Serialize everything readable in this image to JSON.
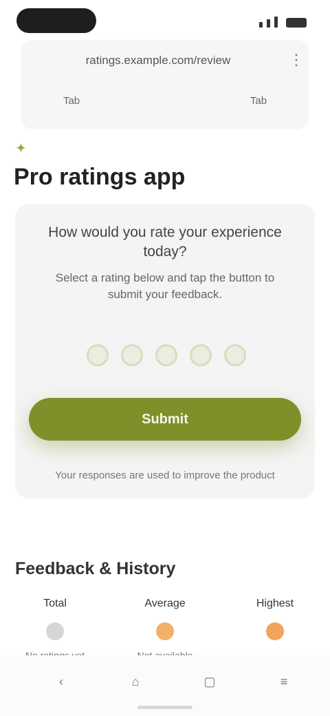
{
  "status_bar": {
    "time": ""
  },
  "browser": {
    "url": "ratings.example.com/review",
    "menu_icon": "more-icon",
    "tabs": [
      "Tab",
      "",
      "Tab"
    ]
  },
  "page": {
    "title": "Pro ratings app",
    "badge_icon": "leaf-icon"
  },
  "survey": {
    "question": "How would you rate your experience today?",
    "hint": "Select a rating below and tap the button to submit your feedback.",
    "rating_count": 5,
    "submit_label": "Submit",
    "footnote": "Your responses are used to improve the product"
  },
  "feedback": {
    "title": "Feedback & History",
    "stats": [
      {
        "label": "Total",
        "icon": "circle-gray",
        "value": "No ratings yet"
      },
      {
        "label": "Average",
        "icon": "circle-orange",
        "value": "Not available"
      },
      {
        "label": "Highest",
        "icon": "circle-orange",
        "value": ""
      }
    ]
  },
  "bottom_nav": {
    "items": [
      {
        "label": "back-icon"
      },
      {
        "label": "home-icon"
      },
      {
        "label": "tabs-icon"
      },
      {
        "label": "menu-icon"
      }
    ]
  },
  "colors": {
    "accent": "#7f8f2a",
    "card_bg": "#f4f4f4",
    "muted": "#777777"
  }
}
